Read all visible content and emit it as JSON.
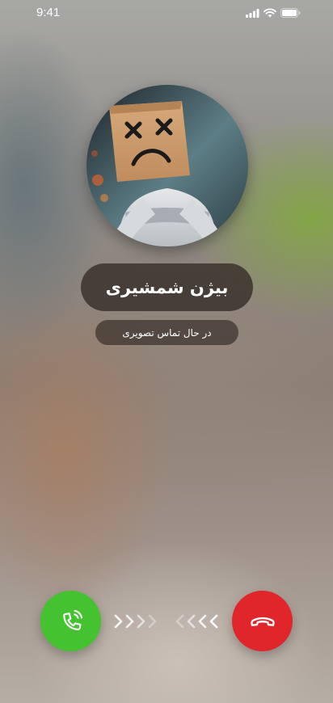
{
  "status_bar": {
    "time": "9:41",
    "icons": [
      "signal-icon",
      "wifi-icon",
      "battery-icon"
    ]
  },
  "call": {
    "caller_name": "بیژن شمشیری",
    "call_status": "در حال تماس تصویری"
  },
  "actions": {
    "accept_icon": "phone-ringing-icon",
    "decline_icon": "phone-hangup-icon",
    "accept_color": "#44c22f",
    "decline_color": "#e0262b"
  }
}
